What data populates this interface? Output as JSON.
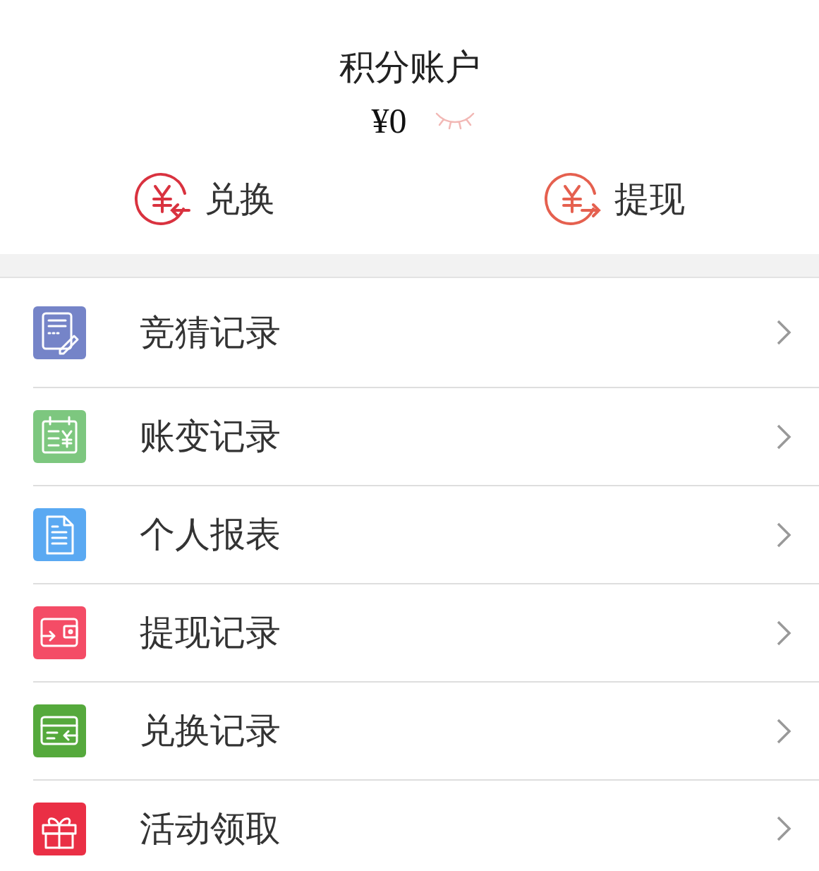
{
  "header": {
    "title": "积分账户",
    "balance": "¥0"
  },
  "actions": [
    {
      "label": "兑换",
      "color": "#d9323f"
    },
    {
      "label": "提现",
      "color": "#e5604f"
    }
  ],
  "menu": [
    {
      "label": "竞猜记录",
      "color": "#7584c8"
    },
    {
      "label": "账变记录",
      "color": "#7dc77f"
    },
    {
      "label": "个人报表",
      "color": "#5aa9f2"
    },
    {
      "label": "提现记录",
      "color": "#f44c66"
    },
    {
      "label": "兑换记录",
      "color": "#55a93c"
    },
    {
      "label": "活动领取",
      "color": "#ea2f45"
    }
  ]
}
